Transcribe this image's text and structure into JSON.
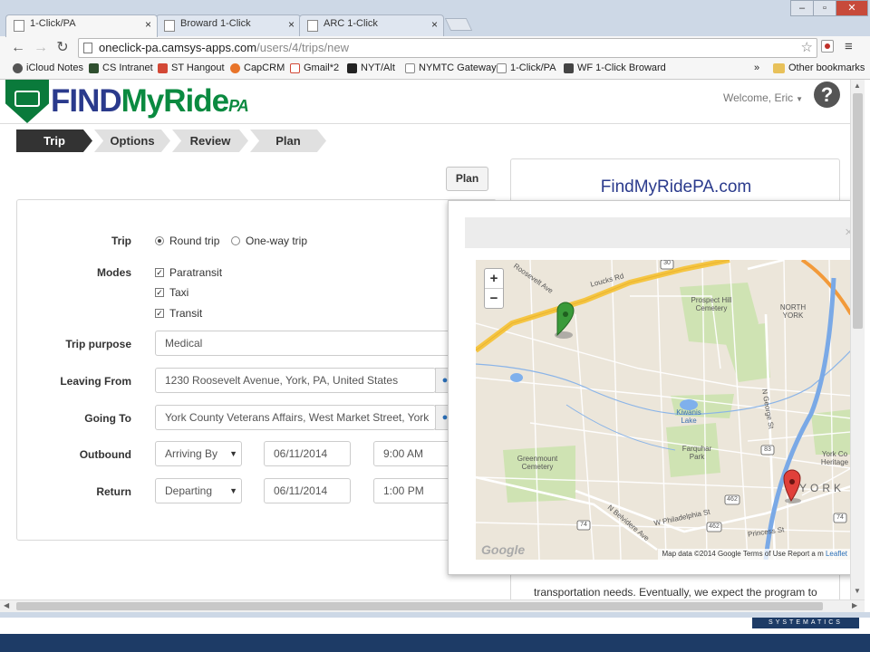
{
  "browser": {
    "tabs": [
      {
        "title": "1-Click/PA",
        "active": true
      },
      {
        "title": "Broward 1-Click",
        "active": false
      },
      {
        "title": "ARC 1-Click",
        "active": false
      }
    ],
    "url_host": "oneclick-pa.camsys-apps.com",
    "url_path": "/users/4/trips/new",
    "bookmarks": [
      {
        "label": "iCloud Notes",
        "color": "#555555"
      },
      {
        "label": "CS Intranet",
        "color": "#2f4f2f"
      },
      {
        "label": "ST Hangout",
        "color": "#d34836"
      },
      {
        "label": "CapCRM",
        "color": "#e8742a"
      },
      {
        "label": "Gmail*2",
        "color": "#d14836"
      },
      {
        "label": "NYT/Alt",
        "color": "#222222"
      },
      {
        "label": "NYMTC Gateway",
        "color": "#888888"
      },
      {
        "label": "1-Click/PA",
        "color": "#888888"
      },
      {
        "label": "WF 1-Click Broward",
        "color": "#444444"
      }
    ],
    "bookmarks_overflow": "»",
    "other_bookmarks": "Other bookmarks"
  },
  "header": {
    "logo": {
      "find": "FIND",
      "myride": "MyRide",
      "pa": "PA"
    },
    "welcome": "Welcome, Eric",
    "help": "?"
  },
  "steps": [
    {
      "label": "Trip",
      "active": true
    },
    {
      "label": "Options",
      "active": false
    },
    {
      "label": "Review",
      "active": false
    },
    {
      "label": "Plan",
      "active": false
    }
  ],
  "plan_button": "Plan",
  "form": {
    "trip_label": "Trip",
    "round_trip": "Round trip",
    "one_way": "One-way trip",
    "modes_label": "Modes",
    "modes": [
      "Paratransit",
      "Taxi",
      "Transit"
    ],
    "purpose_label": "Trip purpose",
    "purpose_value": "Medical",
    "from_label": "Leaving From",
    "from_value": "1230 Roosevelt Avenue, York, PA, United States",
    "to_label": "Going To",
    "to_value": "York County Veterans Affairs, West Market Street, York",
    "outbound_label": "Outbound",
    "outbound_mode": "Arriving By",
    "outbound_date": "06/11/2014",
    "outbound_time": "9:00 AM",
    "return_label": "Return",
    "return_mode": "Departing",
    "return_date": "06/11/2014",
    "return_time": "1:00 PM"
  },
  "side": {
    "title": "FindMyRidePA.com",
    "text": "transportation needs. Eventually, we expect the program to"
  },
  "modal": {
    "close": "×",
    "map": {
      "zoom_in": "+",
      "zoom_out": "−",
      "labels": {
        "loucks": "Loucks Rd",
        "roosevelt": "Roosevelt Ave",
        "prospect": "Prospect Hill Cemetery",
        "north_york": "NORTH YORK",
        "kiwanis": "Kiwanis Lake",
        "farquhar": "Farquhar Park",
        "greenmount": "Greenmount Cemetery",
        "philadelphia": "W Philadelphia St",
        "princess": "Princess St",
        "belvidere": "N Belvidere Ave",
        "george": "N George St",
        "york": "YORK",
        "heritage": "York Co Heritage",
        "r30": "30",
        "r462a": "462",
        "r462b": "462",
        "r74a": "74",
        "r74b": "74",
        "r83": "83"
      },
      "google": "Google",
      "attribution": "Map data ©2014 Google   Terms of Use   Report a m",
      "leaflet": "Leaflet"
    }
  },
  "footer": {
    "brand": "SYSTEMATICS"
  },
  "colors": {
    "brand_green": "#0a7a3b",
    "brand_blue": "#2a3a8c",
    "step_active": "#333333"
  }
}
